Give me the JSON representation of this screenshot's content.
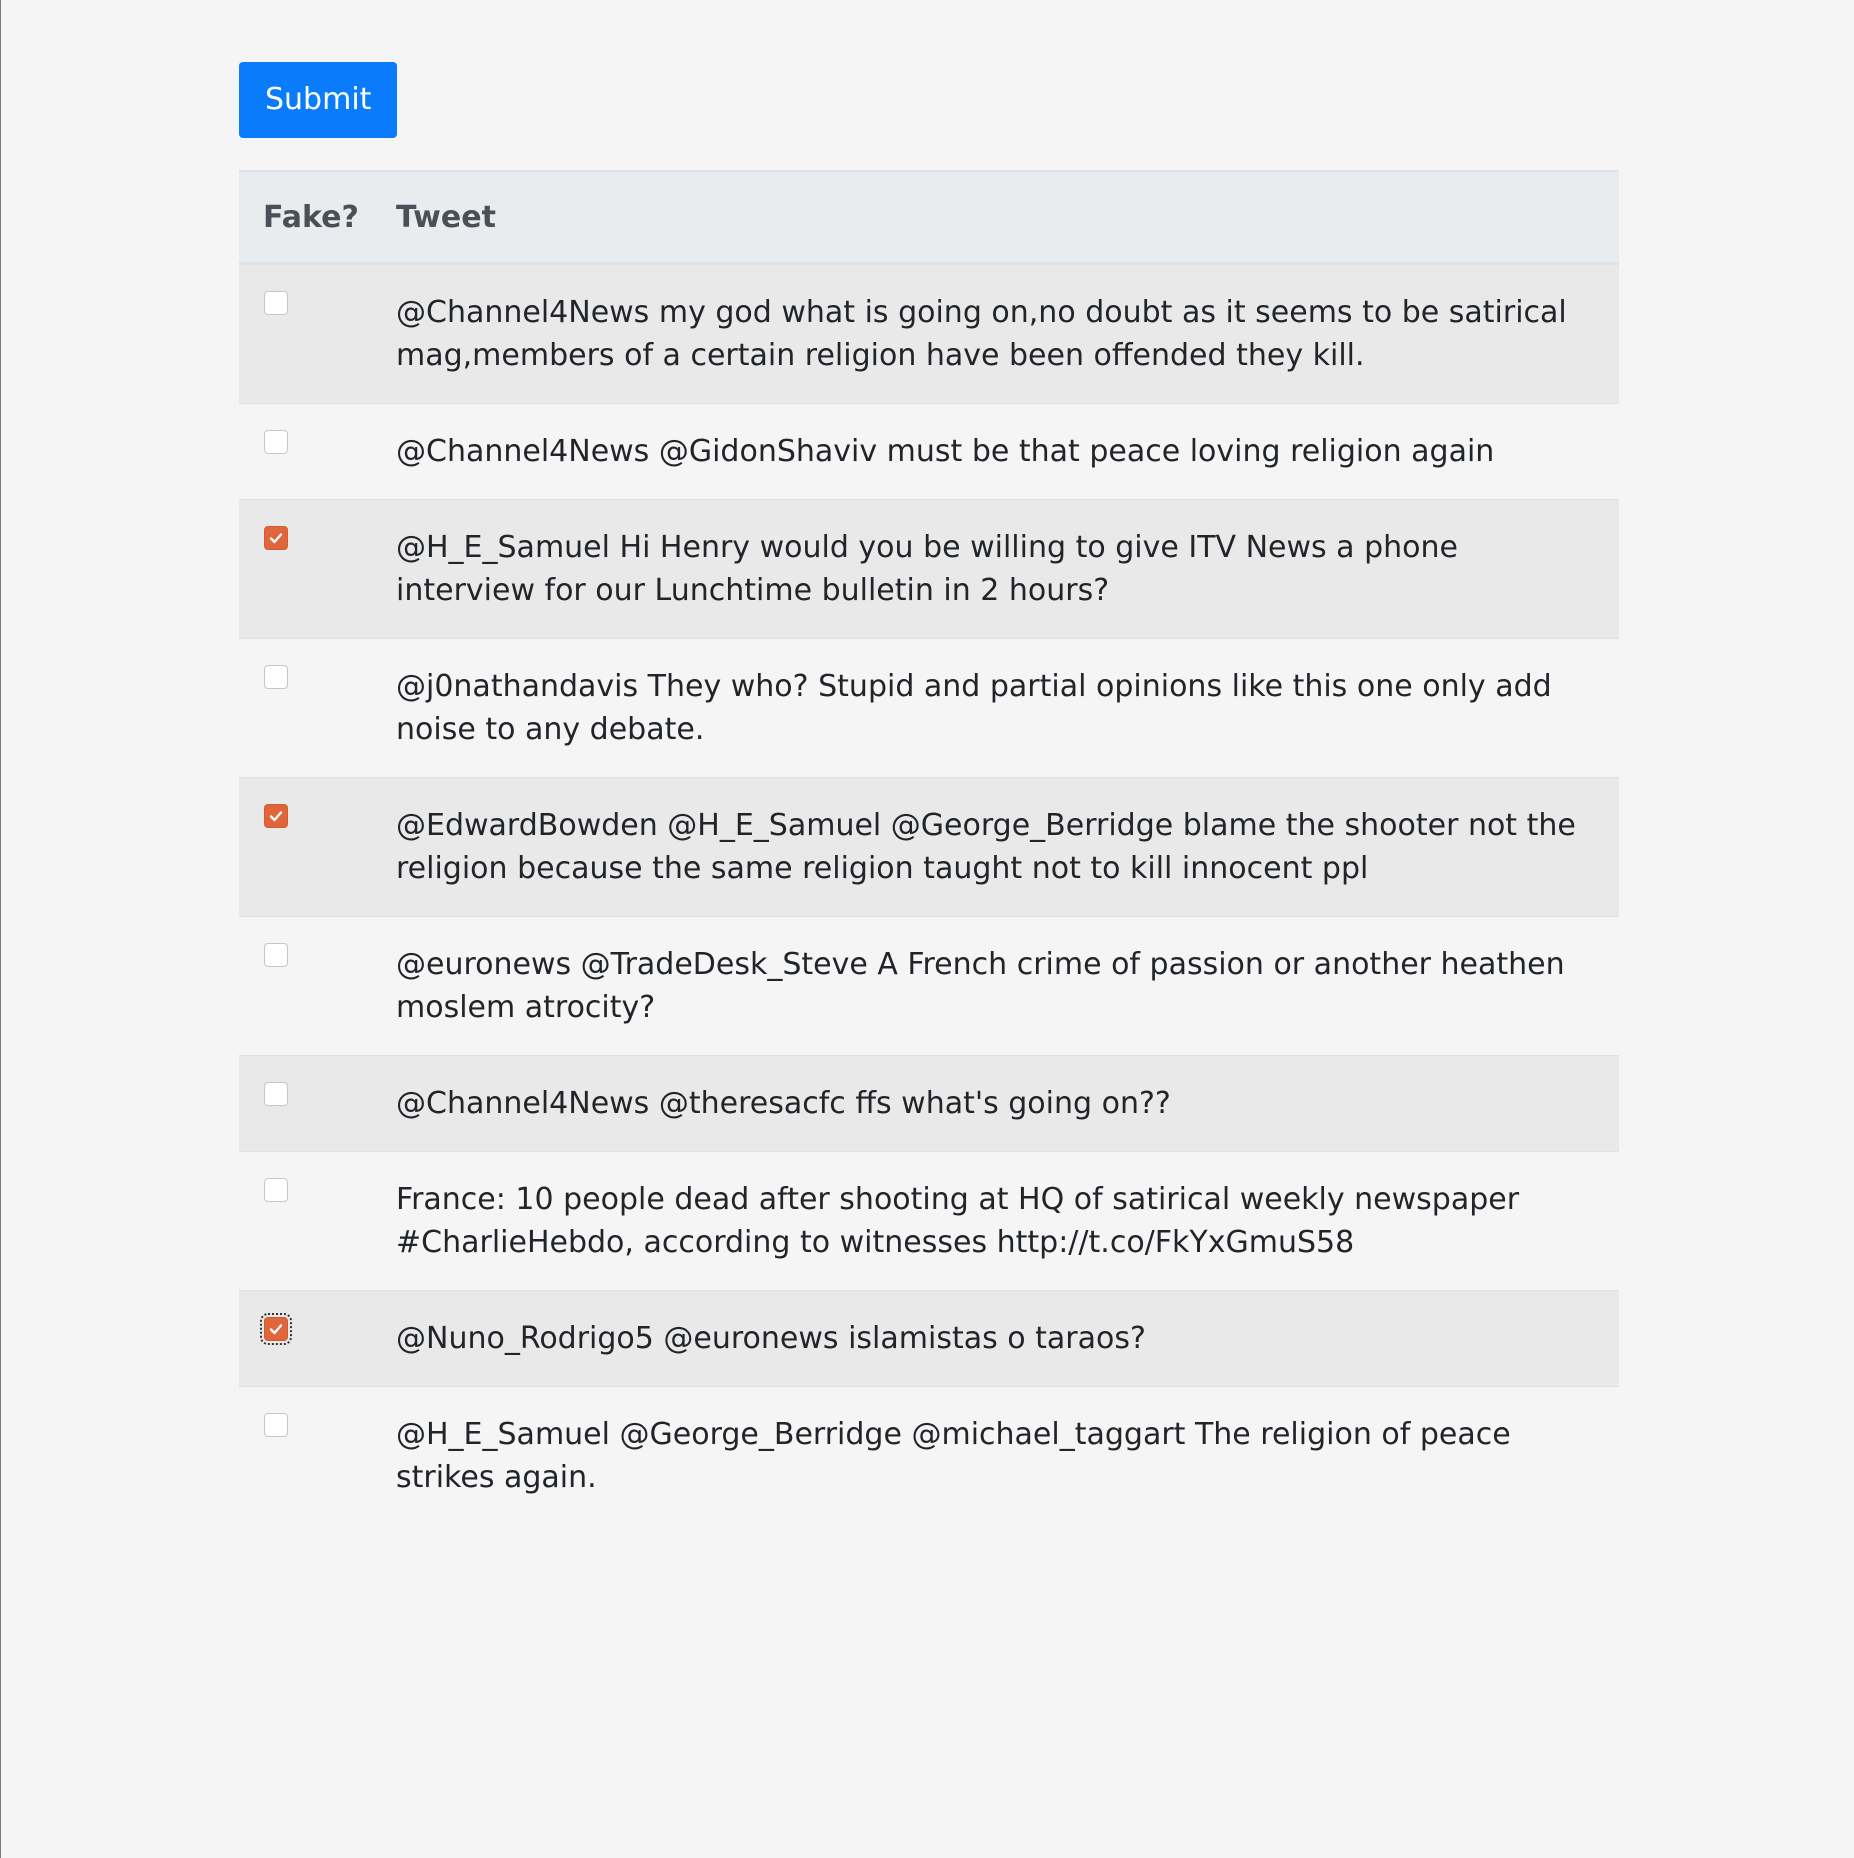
{
  "submit_label": "Submit",
  "table": {
    "headers": [
      "Fake?",
      "Tweet"
    ],
    "rows": [
      {
        "checked": false,
        "text": "@Channel4News my god what is going on,no doubt as it seems to be satirical mag,members of a certain religion have been offended they kill."
      },
      {
        "checked": false,
        "text": "@Channel4News @GidonShaviv must be that peace loving religion again"
      },
      {
        "checked": true,
        "text": "@H_E_Samuel Hi Henry would you be willing to give ITV News a phone interview for our Lunchtime bulletin in 2 hours?"
      },
      {
        "checked": false,
        "text": "@j0nathandavis They who? Stupid and partial opinions like this one only add noise to any debate."
      },
      {
        "checked": true,
        "text": "@EdwardBowden @H_E_Samuel @George_Berridge blame the shooter not the religion because the same religion taught not to kill innocent ppl"
      },
      {
        "checked": false,
        "text": "@euronews @TradeDesk_Steve A French crime of passion or another heathen moslem atrocity?"
      },
      {
        "checked": false,
        "text": "@Channel4News @theresacfc ffs what's going on??"
      },
      {
        "checked": false,
        "text": "France: 10 people dead after shooting at HQ of satirical weekly newspaper #CharlieHebdo, according to witnesses http://t.co/FkYxGmuS58"
      },
      {
        "checked": true,
        "focused": true,
        "text": "@Nuno_Rodrigo5 @euronews islamistas o taraos?"
      },
      {
        "checked": false,
        "text": "@H_E_Samuel @George_Berridge @michael_taggart The religion of peace strikes again."
      }
    ]
  },
  "colors": {
    "primary_button": "#0a7cfb",
    "checkbox_checked": "#e0653a",
    "header_bg": "#e9ecef",
    "striped_row_bg": "#e9e9e9",
    "page_bg": "#f5f5f5"
  },
  "icons": {
    "checkmark": "checkmark-icon"
  }
}
